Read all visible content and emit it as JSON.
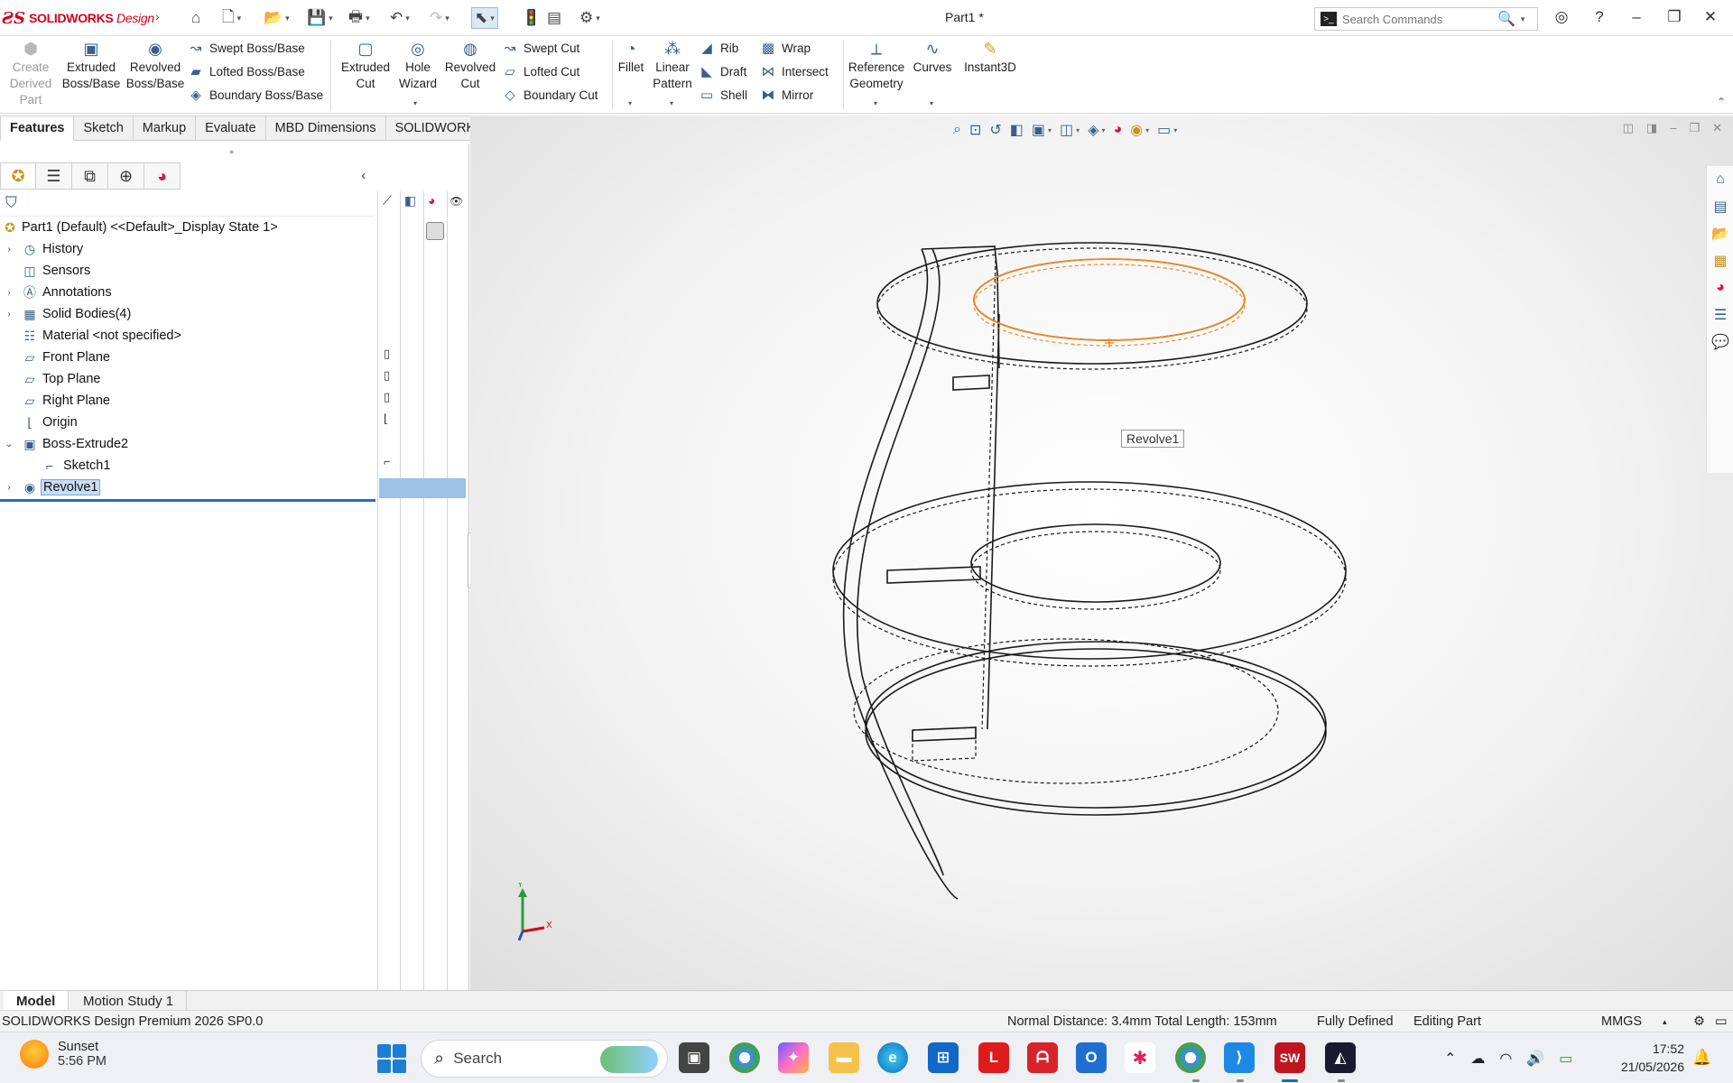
{
  "app": {
    "logo_brand": "SOLIDWORKS",
    "logo_product": "Design",
    "document_title": "Part1 *",
    "search_placeholder": "Search Commands"
  },
  "ribbon": {
    "create_derived_part": "Create\nDerived\nPart",
    "extruded_boss": "Extruded\nBoss/Base",
    "revolved_boss": "Revolved\nBoss/Base",
    "swept_boss": "Swept Boss/Base",
    "lofted_boss": "Lofted Boss/Base",
    "boundary_boss": "Boundary Boss/Base",
    "extruded_cut": "Extruded\nCut",
    "hole_wizard": "Hole\nWizard",
    "revolved_cut": "Revolved\nCut",
    "swept_cut": "Swept Cut",
    "lofted_cut": "Lofted Cut",
    "boundary_cut": "Boundary Cut",
    "fillet": "Fillet",
    "linear_pattern": "Linear\nPattern",
    "rib": "Rib",
    "draft": "Draft",
    "shell": "Shell",
    "wrap": "Wrap",
    "intersect": "Intersect",
    "mirror": "Mirror",
    "reference_geometry": "Reference\nGeometry",
    "curves": "Curves",
    "instant3d": "Instant3D"
  },
  "command_tabs": [
    "Features",
    "Sketch",
    "Markup",
    "Evaluate",
    "MBD Dimensions",
    "SOLIDWORKS Add-Ins"
  ],
  "tree": {
    "root": "Part1 (Default) <<Default>_Display State 1>",
    "items": [
      {
        "label": "History"
      },
      {
        "label": "Sensors"
      },
      {
        "label": "Annotations"
      },
      {
        "label": "Solid Bodies(4)"
      },
      {
        "label": "Material <not specified>"
      },
      {
        "label": "Front Plane"
      },
      {
        "label": "Top Plane"
      },
      {
        "label": "Right Plane"
      },
      {
        "label": "Origin"
      },
      {
        "label": "Boss-Extrude2"
      },
      {
        "label": "Sketch1"
      },
      {
        "label": "Revolve1"
      }
    ]
  },
  "viewport": {
    "tooltip": "Revolve1",
    "triad_y": "Y",
    "triad_x": "X"
  },
  "bottom_tabs": [
    "Model",
    "Motion Study 1"
  ],
  "status": {
    "product": "SOLIDWORKS Design Premium 2026 SP0.0",
    "measure": "Normal Distance: 3.4mm Total Length: 153mm",
    "sketch_state": "Fully Defined",
    "mode": "Editing Part",
    "units": "MMGS"
  },
  "taskbar": {
    "weather_title": "Sunset",
    "weather_time": "5:56 PM",
    "search_label": "Search",
    "clock_time": "17:52",
    "clock_date": "21/05/2026"
  },
  "colors": {
    "accent": "#2d6bb8",
    "highlight_edge": "#f08a24",
    "brand_red": "#d0021b"
  }
}
